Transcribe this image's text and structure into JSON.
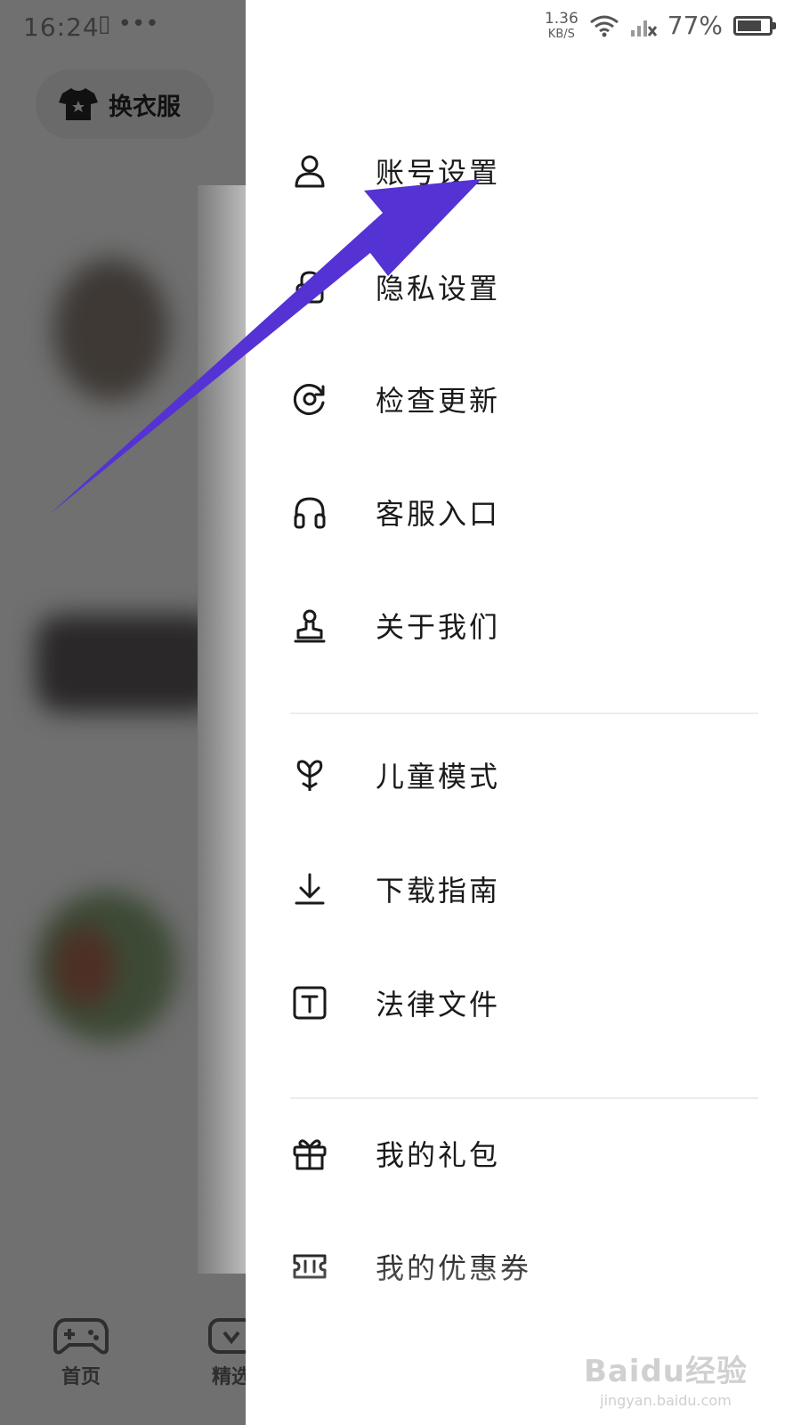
{
  "status_bar": {
    "time": "16:24",
    "left_extra": "▯ •••",
    "netspeed_value": "1.36",
    "netspeed_unit": "KB/S",
    "battery_percent": "77%",
    "battery_level": 0.77
  },
  "background_app": {
    "pill_label": "换衣服",
    "tabs": [
      {
        "label": "首页",
        "icon": "gamepad-icon"
      },
      {
        "label": "精选",
        "icon": "heart-icon"
      }
    ]
  },
  "drawer": {
    "group1": [
      {
        "label": "账号设置",
        "icon": "user-icon"
      },
      {
        "label": "隐私设置",
        "icon": "lock-icon"
      },
      {
        "label": "检查更新",
        "icon": "refresh-icon"
      },
      {
        "label": "客服入口",
        "icon": "headphones-icon"
      },
      {
        "label": "关于我们",
        "icon": "about-icon"
      }
    ],
    "group2": [
      {
        "label": "儿童模式",
        "icon": "sprout-icon"
      },
      {
        "label": "下载指南",
        "icon": "download-icon"
      },
      {
        "label": "法律文件",
        "icon": "document-t-icon"
      }
    ],
    "group3": [
      {
        "label": "我的礼包",
        "icon": "gift-icon"
      },
      {
        "label": "我的优惠券",
        "icon": "coupon-icon"
      }
    ]
  },
  "annotation": {
    "arrow_color": "#5532d4"
  },
  "watermark": {
    "main": "Baidu经验",
    "sub": "jingyan.baidu.com"
  }
}
